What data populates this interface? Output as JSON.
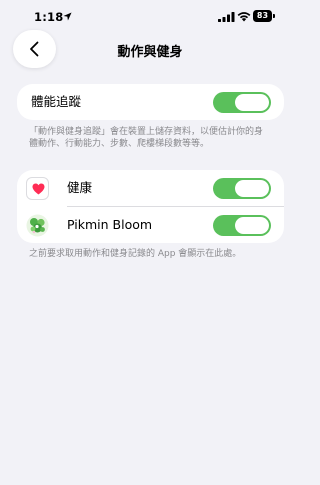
{
  "status_bar": {
    "time": "1:18",
    "battery": "83"
  },
  "nav": {
    "title": "動作與健身"
  },
  "fitness_tracking": {
    "label": "體能追蹤",
    "enabled": true,
    "footnote": "「動作與健身追蹤」會在裝置上儲存資料，以便估計你的身體動作、行動能力、步數、爬樓梯段數等等。"
  },
  "apps": {
    "items": [
      {
        "name": "健康",
        "icon": "health-heart-icon",
        "enabled": true
      },
      {
        "name": "Pikmin Bloom",
        "icon": "pikmin-bloom-icon",
        "enabled": true
      }
    ],
    "footnote": "之前要求取用動作和健身記錄的 App 會顯示在此處。"
  },
  "colors": {
    "toggle_on": "#5ac05b",
    "background": "#f2f2f7",
    "heart": "#ff2d55"
  }
}
